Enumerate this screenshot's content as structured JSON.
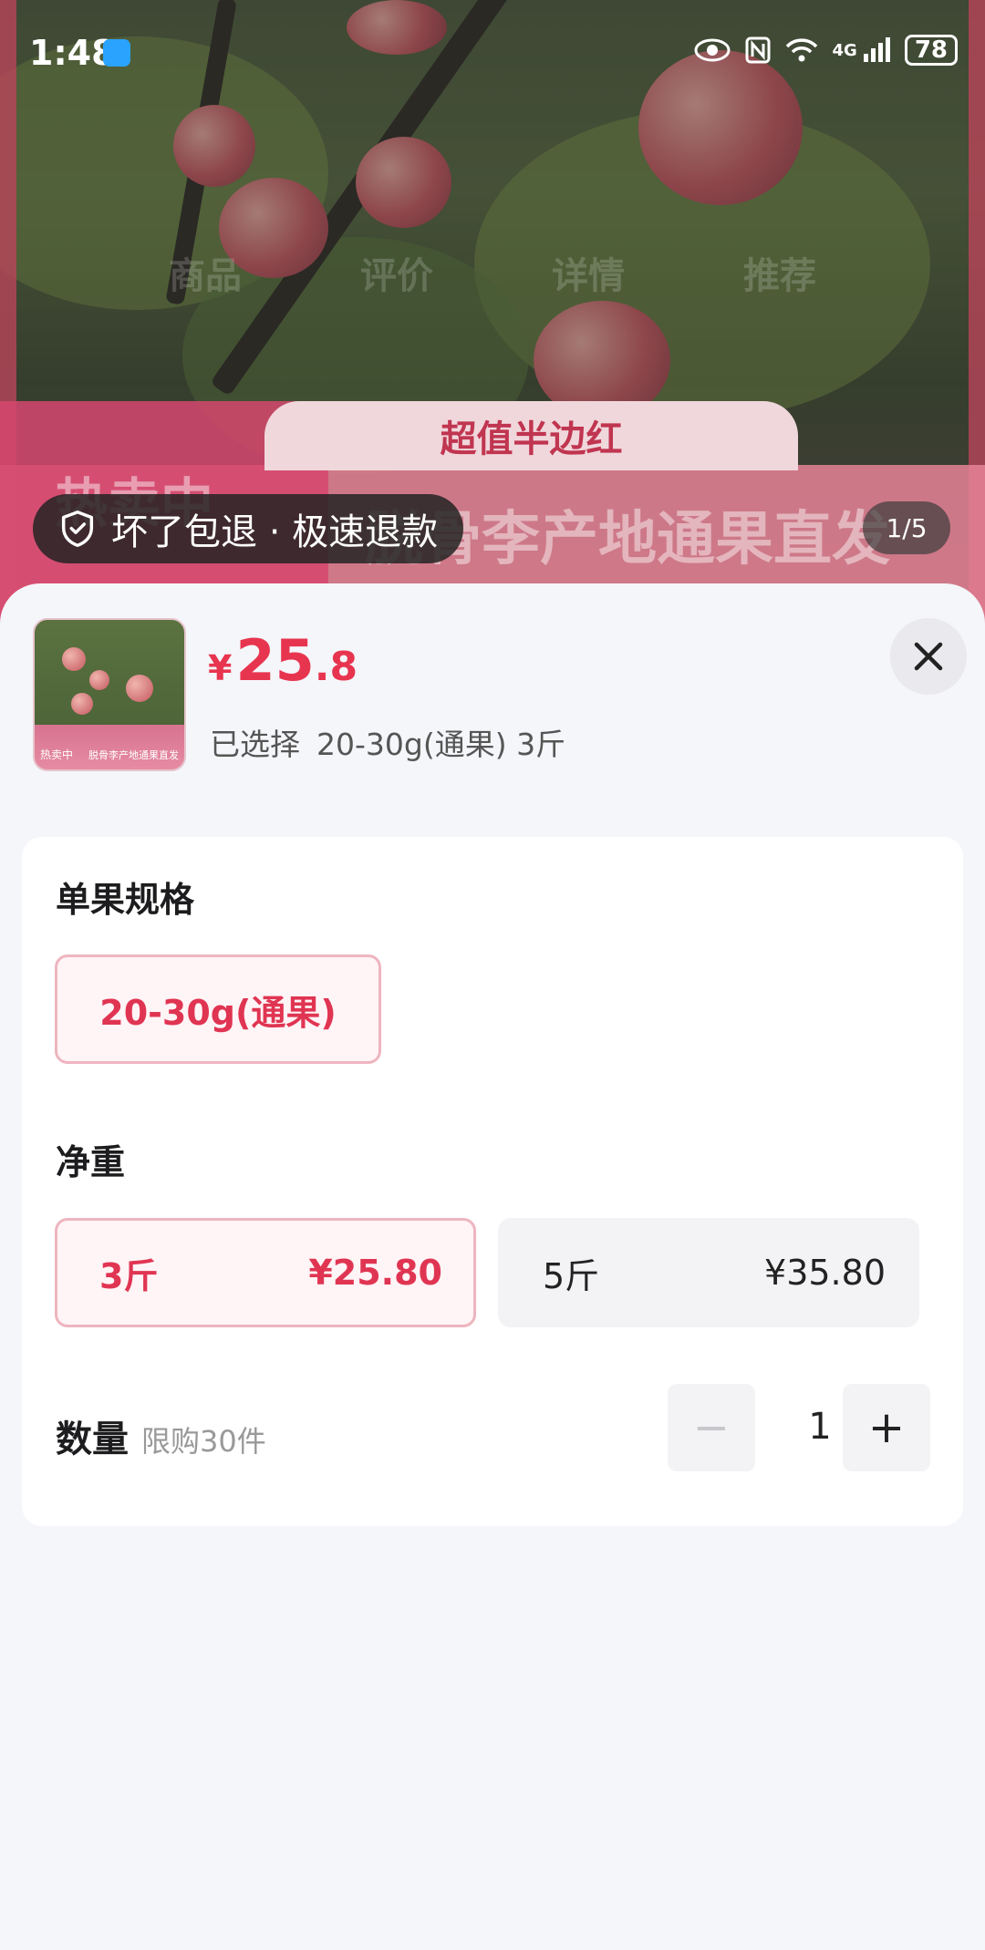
{
  "status_bar": {
    "time": "1:48",
    "battery": "78",
    "network": "4G"
  },
  "hero": {
    "tabs": [
      "商品",
      "评价",
      "详情",
      "推荐"
    ],
    "banner_tag": "超值半边红",
    "banner_hot": "热卖中",
    "banner_title": "脱骨李产地通果直发",
    "guarantee_text": "坏了包退 · 极速退款",
    "image_counter": "1/5"
  },
  "sheet": {
    "thumbnail": {
      "tag": "热卖中",
      "caption": "脱骨李产地通果直发"
    },
    "price": {
      "currency": "¥",
      "integer": "25",
      "decimal": ".8"
    },
    "selected_label": "已选择",
    "selected_value": "20-30g(通果) 3斤",
    "spec_section": {
      "title": "单果规格",
      "options": [
        {
          "label": "20-30g(通果)",
          "selected": true
        }
      ]
    },
    "weight_section": {
      "title": "净重",
      "options": [
        {
          "label": "3斤",
          "price": "¥25.80",
          "selected": true
        },
        {
          "label": "5斤",
          "price": "¥35.80",
          "selected": false
        }
      ]
    },
    "quantity": {
      "label": "数量",
      "limit": "限购30件",
      "value": "1",
      "minus": "−",
      "plus": "+"
    }
  },
  "colors": {
    "accent": "#e8354f",
    "selected_bg": "#fff4f6",
    "selected_border": "#eeb5bf",
    "sheet_bg": "#f5f6fa"
  }
}
